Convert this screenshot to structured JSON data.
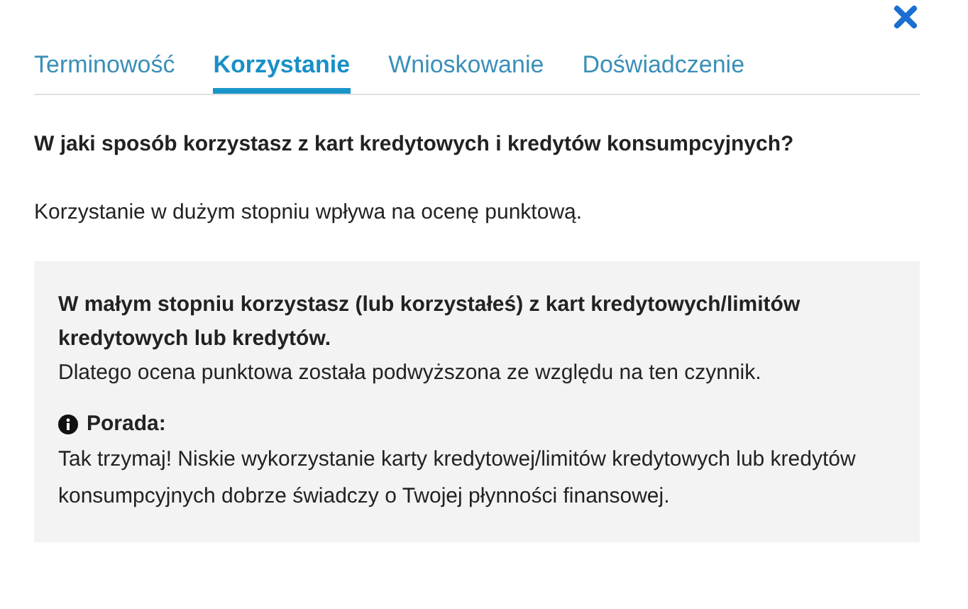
{
  "tabs": [
    {
      "label": "Terminowość",
      "selected": false
    },
    {
      "label": "Korzystanie",
      "selected": true
    },
    {
      "label": "Wnioskowanie",
      "selected": false
    },
    {
      "label": "Doświadczenie",
      "selected": false
    }
  ],
  "question": "W jaki sposób korzystasz z kart kredytowych i kredytów konsumpcyjnych?",
  "intro": "Korzystanie w dużym stopniu wpływa na ocenę punktową.",
  "panel": {
    "headline": "W małym stopniu korzystasz (lub korzystałeś) z kart kredytowych/limitów kredytowych lub kredytów.",
    "result": "Dlatego ocena punktowa została podwyższona ze względu na ten czynnik.",
    "tip_label": "Porada:",
    "tip": "Tak trzymaj! Niskie wykorzystanie karty kredytowej/limitów kredytowych lub kredytów konsumpcyjnych dobrze świadczy o Twojej płynności finansowej."
  }
}
